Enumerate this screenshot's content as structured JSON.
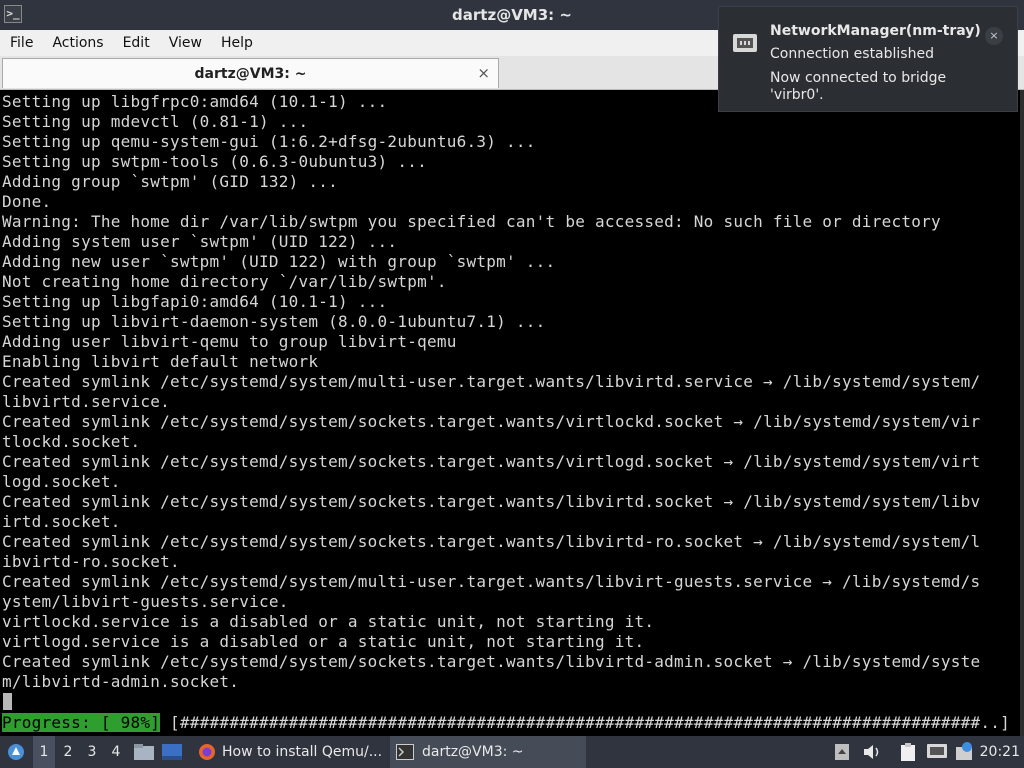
{
  "window": {
    "title": "dartz@VM3: ~"
  },
  "menu": {
    "items": [
      "File",
      "Actions",
      "Edit",
      "View",
      "Help"
    ]
  },
  "tab": {
    "label": "dartz@VM3: ~",
    "close_glyph": "×"
  },
  "terminal": {
    "lines": [
      "Setting up libgfrpc0:amd64 (10.1-1) ...",
      "Setting up mdevctl (0.81-1) ...",
      "Setting up qemu-system-gui (1:6.2+dfsg-2ubuntu6.3) ...",
      "Setting up swtpm-tools (0.6.3-0ubuntu3) ...",
      "Adding group `swtpm' (GID 132) ...",
      "Done.",
      "Warning: The home dir /var/lib/swtpm you specified can't be accessed: No such file or directory",
      "Adding system user `swtpm' (UID 122) ...",
      "Adding new user `swtpm' (UID 122) with group `swtpm' ...",
      "Not creating home directory `/var/lib/swtpm'.",
      "Setting up libgfapi0:amd64 (10.1-1) ...",
      "Setting up libvirt-daemon-system (8.0.0-1ubuntu7.1) ...",
      "Adding user libvirt-qemu to group libvirt-qemu",
      "Enabling libvirt default network",
      "Created symlink /etc/systemd/system/multi-user.target.wants/libvirtd.service → /lib/systemd/system/",
      "libvirtd.service.",
      "Created symlink /etc/systemd/system/sockets.target.wants/virtlockd.socket → /lib/systemd/system/vir",
      "tlockd.socket.",
      "Created symlink /etc/systemd/system/sockets.target.wants/virtlogd.socket → /lib/systemd/system/virt",
      "logd.socket.",
      "Created symlink /etc/systemd/system/sockets.target.wants/libvirtd.socket → /lib/systemd/system/libv",
      "irtd.socket.",
      "Created symlink /etc/systemd/system/sockets.target.wants/libvirtd-ro.socket → /lib/systemd/system/l",
      "ibvirtd-ro.socket.",
      "Created symlink /etc/systemd/system/multi-user.target.wants/libvirt-guests.service → /lib/systemd/s",
      "ystem/libvirt-guests.service.",
      "virtlockd.service is a disabled or a static unit, not starting it.",
      "virtlogd.service is a disabled or a static unit, not starting it.",
      "Created symlink /etc/systemd/system/sockets.target.wants/libvirtd-admin.socket → /lib/systemd/syste",
      "m/libvirtd-admin.socket."
    ],
    "progress_label": "Progress: [ 98%]",
    "progress_bar": "[#################################################################################..]",
    "progress_value": 0.98
  },
  "notification": {
    "title": "NetworkManager(nm-tray)",
    "body1": "Connection established",
    "body2": "Now connected to bridge 'virbr0'.",
    "close_glyph": "×",
    "icon": "network-wired-icon"
  },
  "taskbar": {
    "workspaces": [
      "1",
      "2",
      "3",
      "4"
    ],
    "active_workspace": "1",
    "tasks": [
      {
        "label": "How to install Qemu/...",
        "icon": "firefox-icon"
      },
      {
        "label": "dartz@VM3: ~",
        "icon": "terminal-icon"
      }
    ],
    "clock": "20:21"
  },
  "colors": {
    "titlebar": "#2f343f",
    "terminal_bg": "#000000",
    "terminal_fg": "#d6d6d6",
    "progress_green": "#2e9e2e",
    "notification_bg": "#2b2e33"
  }
}
